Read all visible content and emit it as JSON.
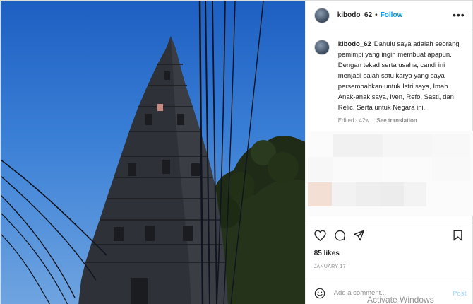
{
  "post": {
    "username": "kibodo_62",
    "follow_label": "Follow",
    "separator": "•",
    "more_label": "•••",
    "caption": "Dahulu saya adalah seorang pemimpi yang ingin membuat apapun. Dengan tekad serta usaha, candi ini menjadi salah satu karya yang saya persembahkan untuk Istri saya, Imah. Anak-anak saya, Iven, Refo, Sasti, dan Relic. Serta untuk Negara ini.",
    "edited": "Edited · 42w",
    "see_translation": "See translation",
    "likes": "85 likes",
    "date": "JANUARY 17"
  },
  "comment": {
    "placeholder": "Add a comment...",
    "post_label": "Post"
  },
  "icons": {
    "like": "heart-icon",
    "comment": "comment-icon",
    "share": "paper-plane-icon",
    "save": "bookmark-icon",
    "emoji": "smiley-icon"
  },
  "colors": {
    "accent": "#0095f6",
    "sky": "#2f74d0",
    "muted": "#8e8e8e"
  },
  "overlay": {
    "watermark": "Activate Windows"
  }
}
